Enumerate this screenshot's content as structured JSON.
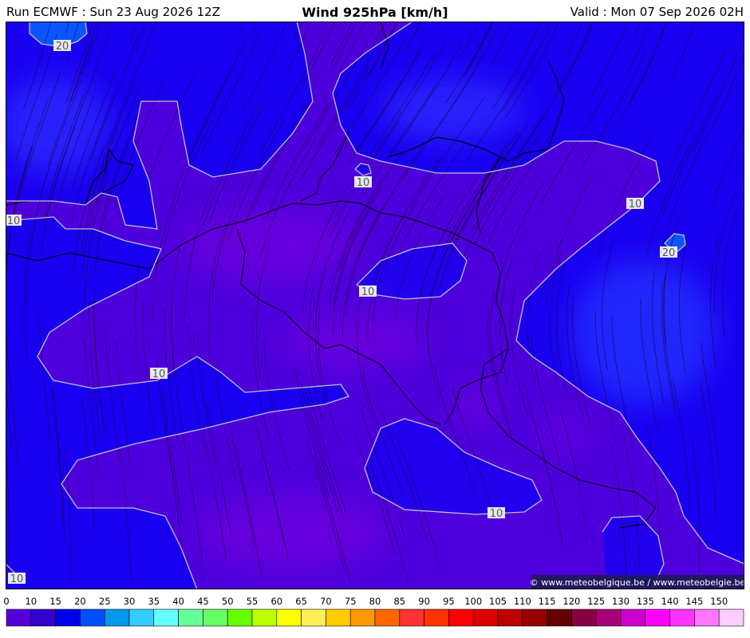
{
  "header": {
    "run_label": "Run ECMWF : Sun 23 Aug 2026 12Z",
    "title": "Wind 925hPa [km/h]",
    "valid_label": "Valid : Mon 07 Sep 2026 02H"
  },
  "credit": "© www.meteobelgique.be / www.meteobelgie.be",
  "contour_labels": [
    {
      "id": "c20-nw",
      "text": "20"
    },
    {
      "id": "c10-north-islet",
      "text": "10"
    },
    {
      "id": "c10-west",
      "text": "10"
    },
    {
      "id": "c10-northeast",
      "text": "10"
    },
    {
      "id": "c20-east",
      "text": "20"
    },
    {
      "id": "c10-center",
      "text": "10"
    },
    {
      "id": "c10-southwest",
      "text": "10"
    },
    {
      "id": "c10-south",
      "text": "10"
    },
    {
      "id": "c10-bottomleft",
      "text": "10"
    }
  ],
  "colorbar": {
    "unit": "km/h",
    "ticks": [
      "0",
      "10",
      "15",
      "20",
      "25",
      "30",
      "35",
      "40",
      "45",
      "50",
      "55",
      "60",
      "65",
      "70",
      "75",
      "80",
      "85",
      "90",
      "95",
      "100",
      "105",
      "110",
      "115",
      "120",
      "125",
      "130",
      "135",
      "140",
      "145",
      "150"
    ],
    "colors": [
      "#5500d9",
      "#3300cc",
      "#0000e8",
      "#0050ff",
      "#0099ee",
      "#33ccff",
      "#66ffff",
      "#66ff99",
      "#66ff66",
      "#66ff00",
      "#bbff00",
      "#ffff00",
      "#ffee55",
      "#ffcc00",
      "#ff9900",
      "#ff6600",
      "#ff3333",
      "#ff3300",
      "#ff0000",
      "#dd0000",
      "#bb0000",
      "#990000",
      "#660000",
      "#880044",
      "#aa0077",
      "#cc00cc",
      "#ff00ff",
      "#ff33ff",
      "#ff77ff",
      "#ffccff"
    ]
  }
}
